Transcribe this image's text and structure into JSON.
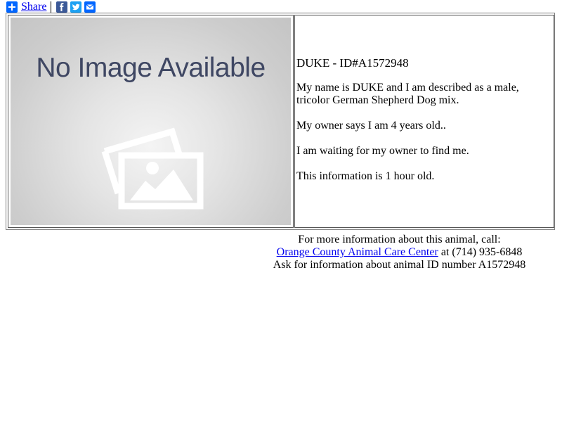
{
  "share": {
    "label": "Share",
    "icons": [
      "share-plus-icon",
      "facebook-icon",
      "twitter-icon",
      "email-icon"
    ]
  },
  "image": {
    "placeholder_text": "No Image Available",
    "icon": "photo-placeholder-icon"
  },
  "animal": {
    "heading": "DUKE - ID#A1572948",
    "description": "My name is DUKE and I am described as a male, tricolor German Shepherd Dog mix.",
    "age": "My owner says I am 4 years old..",
    "status": "I am waiting for my owner to find me.",
    "freshness": "This information is 1 hour old."
  },
  "footer": {
    "intro": "For more information about this animal, call:",
    "center_link": "Orange County Animal Care Center",
    "phone": " at (714) 935-6848",
    "ask": "Ask for information about animal ID number A1572948"
  },
  "colors": {
    "link": "#0000ee",
    "share_blue": "#0166ff",
    "facebook": "#3b5998",
    "twitter": "#1da1f2",
    "placeholder_text": "#3f4763"
  }
}
